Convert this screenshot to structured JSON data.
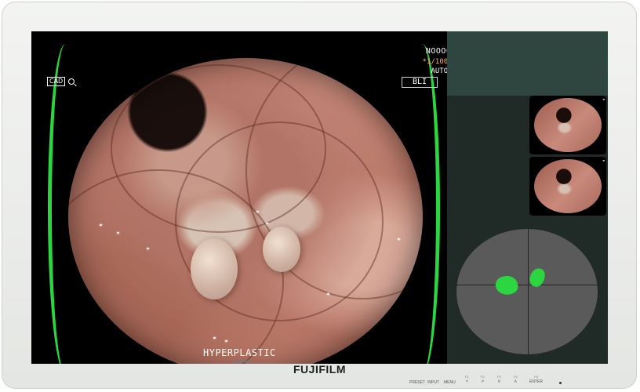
{
  "screen": {
    "cad_label": "CAD",
    "device_id": "NOOOOF",
    "shutter": "*1/100",
    "exposure_mode": "AUTO",
    "light_mode": "BLI",
    "diagnosis": "HYPERPLASTIC"
  },
  "colors": {
    "cad_detection": "#2bd640",
    "panel_bg": "#202a26",
    "panel_header": "#2e4540",
    "map_bg": "#5a5a5a"
  },
  "icons": [
    "zoom-icon",
    "shutter-mode-icon",
    "auto-mode-icon"
  ],
  "monitor": {
    "brand": "FUJIFILM",
    "buttons": {
      "preset": "PRESET",
      "input": "INPUT",
      "menu": "MENU",
      "f1": "F1",
      "f2": "F2",
      "f3": "F3",
      "f4": "F4",
      "f5": "F5",
      "enter": "ENTER",
      "arrow_left": "<",
      "arrow_right": ">",
      "arrow_down": "∨",
      "arrow_up": "∧"
    }
  }
}
